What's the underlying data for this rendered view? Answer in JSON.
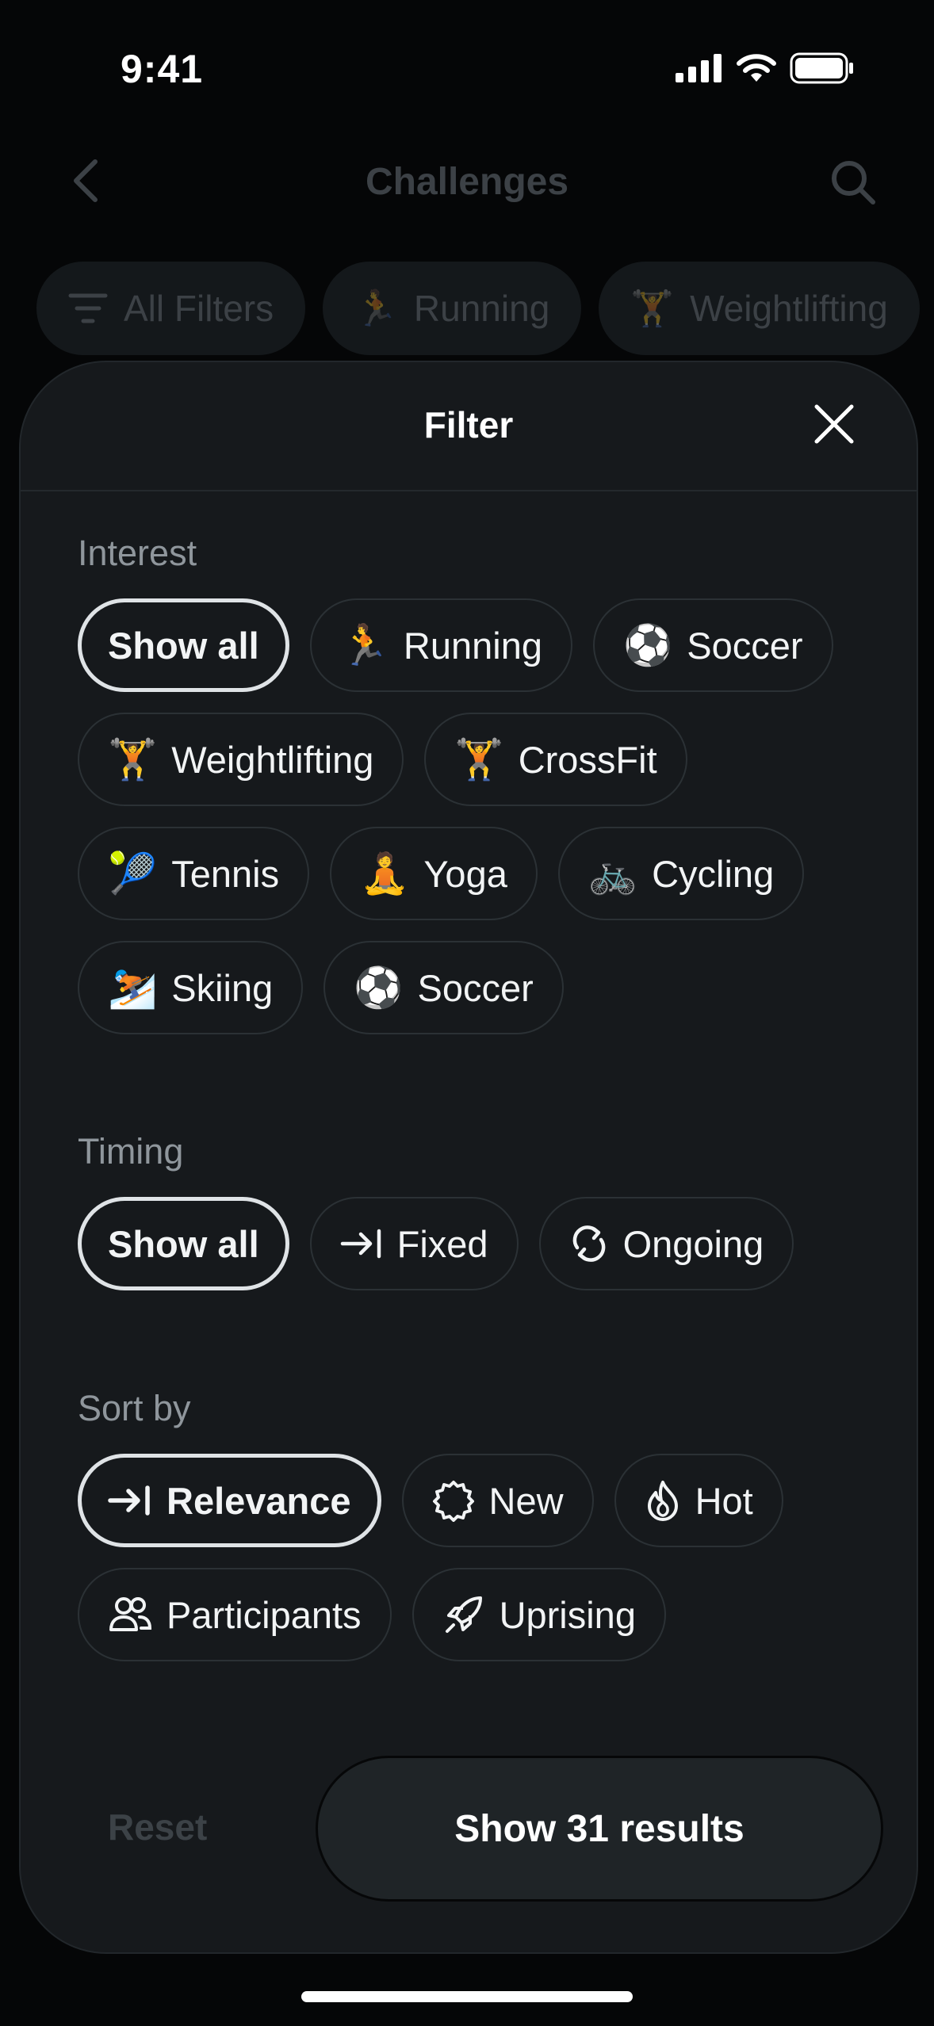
{
  "status_bar": {
    "time": "9:41"
  },
  "background": {
    "title": "Challenges",
    "chips": [
      {
        "icon": "filter-lines-icon",
        "label": "All Filters"
      },
      {
        "icon": "🏃",
        "label": "Running"
      },
      {
        "icon": "🏋️",
        "label": "Weightlifting"
      }
    ]
  },
  "sheet": {
    "title": "Filter",
    "interest": {
      "title": "Interest",
      "options": [
        {
          "icon": "",
          "label": "Show all",
          "selected": true
        },
        {
          "icon": "🏃",
          "label": "Running"
        },
        {
          "icon": "⚽",
          "label": "Soccer"
        },
        {
          "icon": "🏋️",
          "label": "Weightlifting"
        },
        {
          "icon": "🏋️",
          "label": "CrossFit"
        },
        {
          "icon": "🎾",
          "label": "Tennis"
        },
        {
          "icon": "🧘",
          "label": "Yoga"
        },
        {
          "icon": "🚲",
          "label": "Cycling"
        },
        {
          "icon": "⛷️",
          "label": "Skiing"
        },
        {
          "icon": "⚽",
          "label": "Soccer"
        }
      ]
    },
    "timing": {
      "title": "Timing",
      "options": [
        {
          "label": "Show all",
          "selected": true
        },
        {
          "icon": "arrow-to-line-icon",
          "label": "Fixed"
        },
        {
          "icon": "refresh-icon",
          "label": "Ongoing"
        }
      ]
    },
    "sort": {
      "title": "Sort by",
      "options": [
        {
          "icon": "arrow-to-line-icon",
          "label": "Relevance",
          "selected": true
        },
        {
          "icon": "badge-icon",
          "label": "New"
        },
        {
          "icon": "flame-icon",
          "label": "Hot"
        },
        {
          "icon": "users-icon",
          "label": "Participants"
        },
        {
          "icon": "rocket-icon",
          "label": "Uprising"
        }
      ]
    },
    "footer": {
      "reset_label": "Reset",
      "results_label": "Show 31 results"
    }
  }
}
